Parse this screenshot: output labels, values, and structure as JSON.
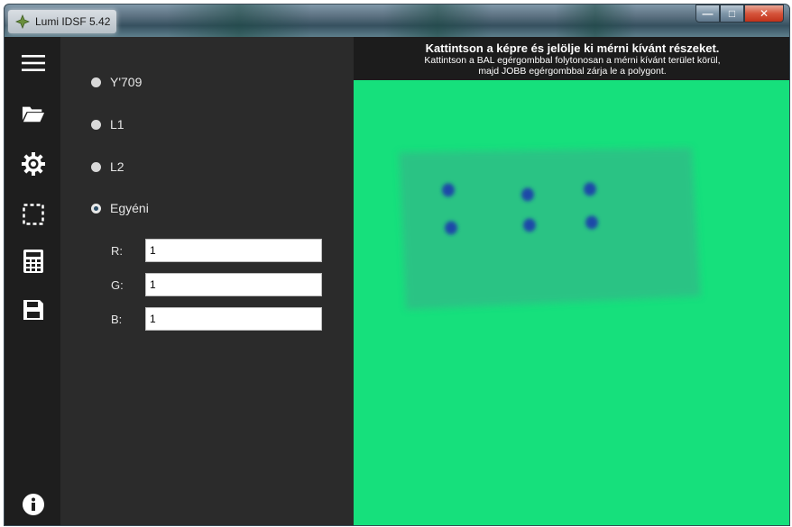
{
  "window": {
    "title": "Lumi IDSF 5.42",
    "controls": {
      "minimize": "—",
      "maximize": "□",
      "close": "✕"
    }
  },
  "sidebar": {
    "items": [
      {
        "icon": "hamburger-menu-icon"
      },
      {
        "icon": "folder-open-icon"
      },
      {
        "icon": "gear-icon"
      },
      {
        "icon": "selection-rectangle-icon"
      },
      {
        "icon": "calculator-icon"
      },
      {
        "icon": "floppy-disk-save-icon"
      },
      {
        "icon": "info-circle-icon"
      }
    ]
  },
  "options": {
    "radios": [
      {
        "label": "Y'709",
        "checked": false
      },
      {
        "label": "L1",
        "checked": false
      },
      {
        "label": "L2",
        "checked": false
      },
      {
        "label": "Egyéni",
        "checked": true
      }
    ],
    "fields": [
      {
        "label": "R:",
        "value": "1"
      },
      {
        "label": "G:",
        "value": "1"
      },
      {
        "label": "B:",
        "value": "1"
      }
    ]
  },
  "instructions": {
    "title": "Kattintson a képre és jelölje ki mérni kívánt részeket.",
    "line1": "Kattintson a BAL egérgombbal folytonosan a mérni kívánt terület körül,",
    "line2": "majd JOBB egérgombbal zárja le a polygont."
  },
  "colors": {
    "image_background": "#16e07c",
    "strip": "#2fbf86",
    "dots": "#1d4aa8",
    "sidebar": "#1e1e1e",
    "panel": "#2b2b2b"
  }
}
